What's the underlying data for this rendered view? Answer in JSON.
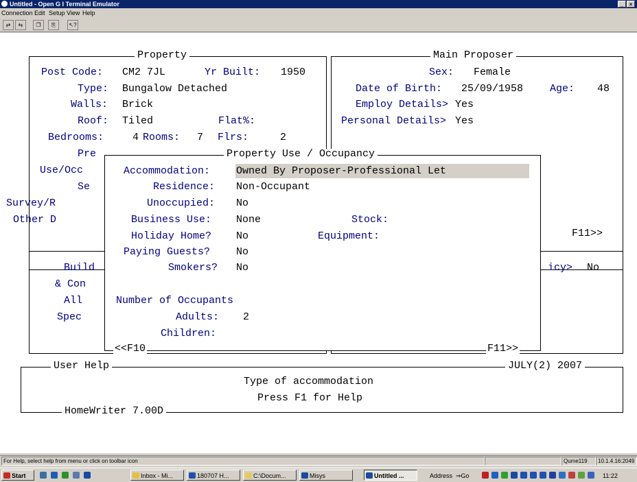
{
  "window": {
    "title": "Untitled - Open G I Terminal Emulator",
    "controls": [
      "_",
      "×"
    ]
  },
  "menu": [
    "Connection",
    "Edit",
    "Setup",
    "View",
    "Help"
  ],
  "toolbar": {
    "icons": [
      "connect-icon",
      "disconnect-icon",
      "copy-icon",
      "paste-icon",
      "help-pointer-icon"
    ]
  },
  "property": {
    "title": "Property",
    "post_code_label": "Post Code:",
    "post_code": "CM2 7JL",
    "yr_built_label": "Yr Built:",
    "yr_built": "1950",
    "type_label": "Type:",
    "type": "Bungalow Detached",
    "walls_label": "Walls:",
    "walls": "Brick",
    "roof_label": "Roof:",
    "roof": "Tiled",
    "flat_label": "Flat%:",
    "bedrooms_label": "Bedrooms:",
    "bedrooms": "4",
    "rooms_label": "Rooms:",
    "rooms": "7",
    "flrs_label": "Flrs:",
    "flrs": "2",
    "pre": "Pre",
    "use_occ": "Use/Occ",
    "se": "Se",
    "survey": "Survey/R",
    "other": "Other D"
  },
  "proposer": {
    "title": "Main Proposer",
    "sex_label": "Sex:",
    "sex": "Female",
    "dob_label": "Date of Birth:",
    "dob": "25/09/1958",
    "age_label": "Age:",
    "age": "48",
    "employ_label": "Employ Details>",
    "employ": "Yes",
    "personal_label": "Personal Details>",
    "personal": "Yes",
    "f11": "F11>>"
  },
  "lower_left": {
    "build": "Build",
    "con": "& Con",
    "all": "All",
    "spec": "Spec"
  },
  "lower_right": {
    "icy_label": "icy>",
    "icy": "No"
  },
  "occupancy": {
    "title": "Property Use / Occupancy",
    "accommodation_label": "Accommodation:",
    "accommodation": "Owned By Proposer-Professional Let",
    "residence_label": "Residence:",
    "residence": "Non-Occupant",
    "unoccupied_label": "Unoccupied:",
    "unoccupied": "No",
    "business_label": "Business Use:",
    "business": "None",
    "stock_label": "Stock:",
    "holiday_label": "Holiday Home?",
    "holiday": "No",
    "equipment_label": "Equipment:",
    "paying_label": "Paying Guests?",
    "paying": "No",
    "smokers_label": "Smokers?",
    "smokers": "No",
    "occupants_label": "Number of Occupants",
    "adults_label": "Adults:",
    "adults": "2",
    "children_label": "Children:",
    "prev": "<<F10",
    "next": "F11>>"
  },
  "help": {
    "title": "User Help",
    "date": "JULY(2) 2007",
    "line1": "Type of accommodation",
    "line2": "Press F1 for Help",
    "version": "HomeWriter 7.00D"
  },
  "statusbar": {
    "message": "For Help, select help from menu or click on toolbar icon",
    "terminal": "Qume119",
    "address": "10.1.4.16:2049"
  },
  "taskbar": {
    "start": "Start",
    "tasks": [
      "Inbox - Mi...",
      "180707 H...",
      "C:\\Docum...",
      "Misys",
      "Untitled ..."
    ],
    "address_label": "Address",
    "go": "Go",
    "clock": "11:22"
  }
}
